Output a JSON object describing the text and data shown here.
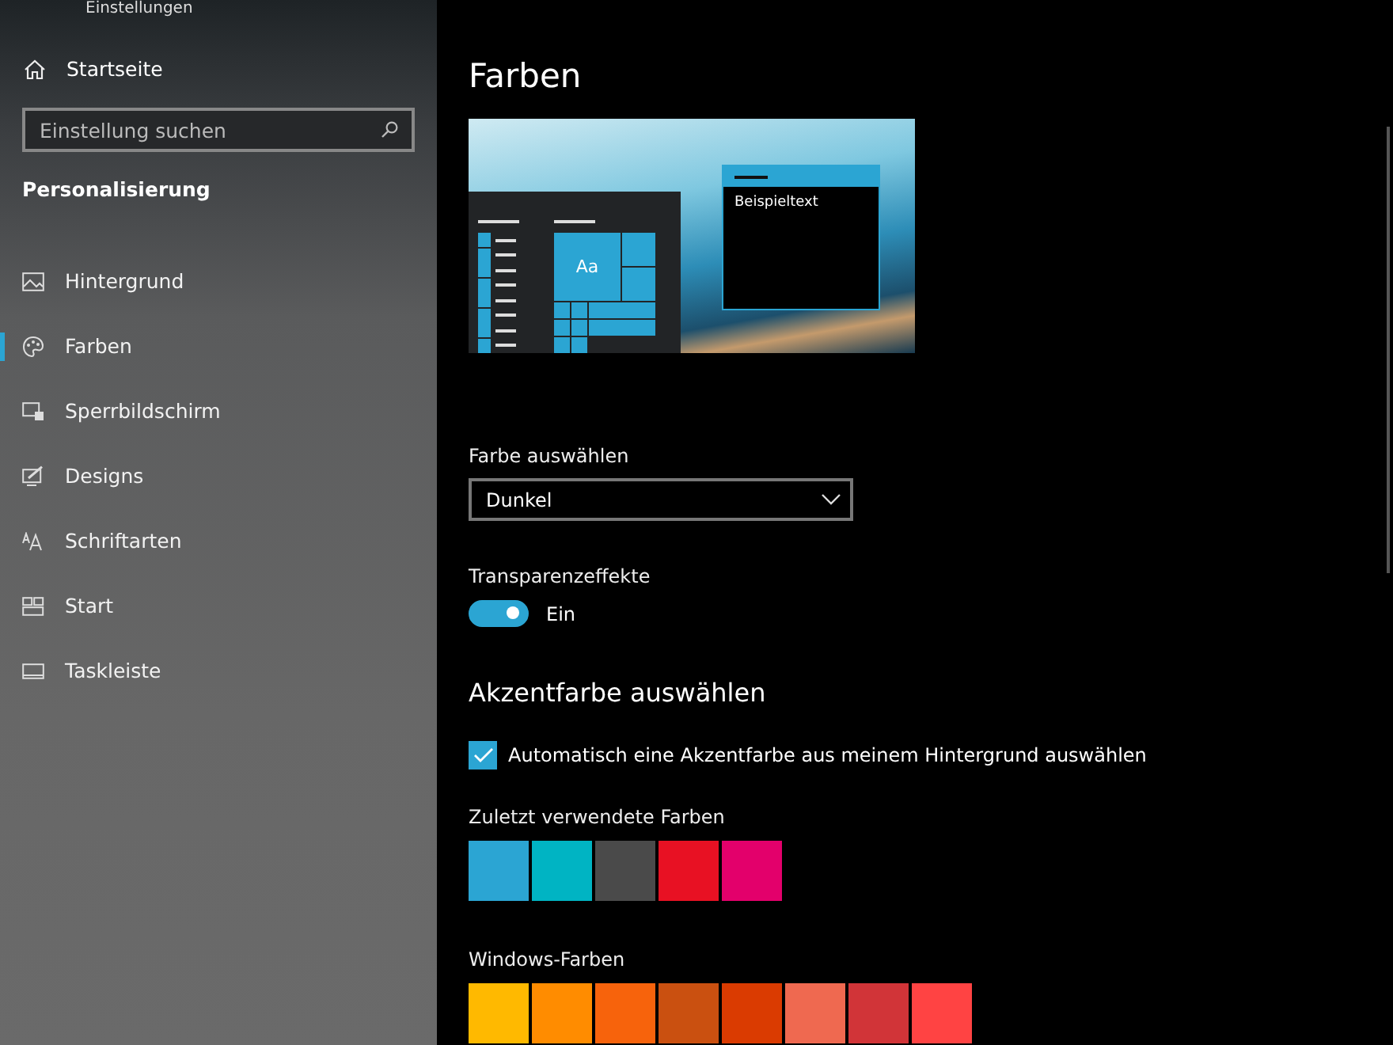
{
  "window": {
    "title": "Einstellungen"
  },
  "sidebar": {
    "home": "Startseite",
    "search": {
      "placeholder": "Einstellung suchen"
    },
    "section": "Personalisierung",
    "items": [
      {
        "label": "Hintergrund",
        "kind": "picture",
        "selected": false
      },
      {
        "label": "Farben",
        "kind": "palette",
        "selected": true
      },
      {
        "label": "Sperrbildschirm",
        "kind": "lockscreen",
        "selected": false
      },
      {
        "label": "Designs",
        "kind": "designs",
        "selected": false
      },
      {
        "label": "Schriftarten",
        "kind": "fonts",
        "selected": false
      },
      {
        "label": "Start",
        "kind": "start",
        "selected": false
      },
      {
        "label": "Taskleiste",
        "kind": "taskbar",
        "selected": false
      }
    ]
  },
  "page": {
    "title": "Farben",
    "preview": {
      "tile_text": "Aa",
      "window_text": "Beispieltext"
    },
    "color_mode": {
      "label": "Farbe auswählen",
      "value": "Dunkel"
    },
    "transparency": {
      "label": "Transparenzeffekte",
      "on": true,
      "state_text": "Ein"
    },
    "accent_heading": "Akzentfarbe auswählen",
    "auto_accent": {
      "label": "Automatisch eine Akzentfarbe aus meinem Hintergrund auswählen",
      "checked": true
    },
    "recent": {
      "label": "Zuletzt verwendete Farben",
      "colors": [
        {
          "color": "#2ba5d3"
        },
        {
          "color": "#00b4c3"
        },
        {
          "color": "#4a4a4a"
        },
        {
          "color": "#e81123"
        },
        {
          "color": "#e3006b"
        }
      ]
    },
    "windows_colors": {
      "label": "Windows-Farben",
      "colors": [
        {
          "color": "#ffb900"
        },
        {
          "color": "#ff8c00"
        },
        {
          "color": "#f7630c"
        },
        {
          "color": "#ca5010"
        },
        {
          "color": "#da3b01"
        },
        {
          "color": "#ef6950"
        },
        {
          "color": "#d13438"
        },
        {
          "color": "#ff4343"
        }
      ]
    }
  }
}
